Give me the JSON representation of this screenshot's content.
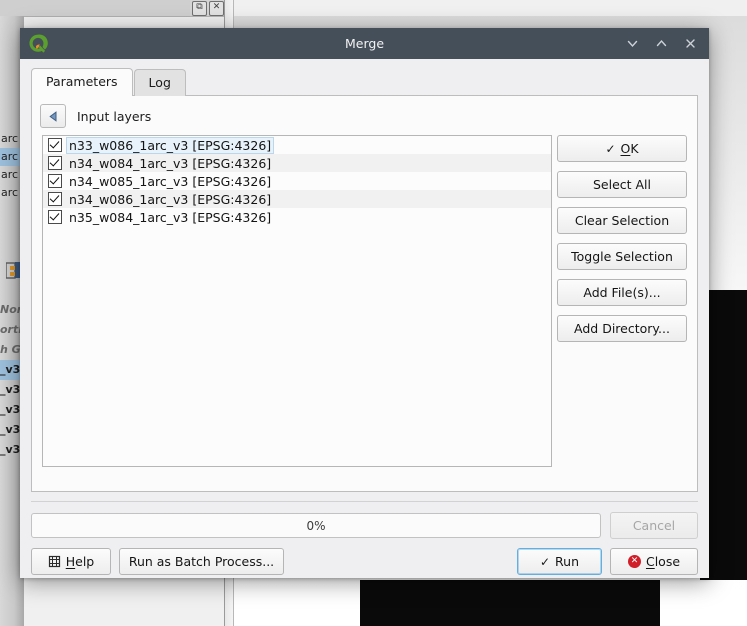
{
  "background": {
    "panel_buttons": [
      {
        "name": "restore-panel",
        "glyph": "⧉"
      },
      {
        "name": "close-panel",
        "glyph": "✕"
      }
    ],
    "layer_rows": [
      "arc",
      "arc",
      "arc",
      "arc"
    ],
    "legend_italic": [
      "Nor",
      "orth",
      "h GA"
    ],
    "legend_layers": [
      "_v3",
      "_v3",
      "_v3",
      "_v3",
      "_v3"
    ]
  },
  "dialog": {
    "title": "Merge",
    "logo_name": "qgis-logo",
    "window_buttons": [
      {
        "name": "minimize",
        "glyph": "minimize"
      },
      {
        "name": "maximize",
        "glyph": "maximize"
      },
      {
        "name": "close",
        "glyph": "close"
      }
    ],
    "tabs": [
      {
        "label": "Parameters",
        "active": true
      },
      {
        "label": "Log",
        "active": false
      }
    ],
    "parameters": {
      "section_label": "Input layers",
      "collapse_icon": "triangle-left-icon",
      "layers": [
        {
          "label": "n33_w086_1arc_v3 [EPSG:4326]",
          "checked": true,
          "focused": true
        },
        {
          "label": "n34_w084_1arc_v3 [EPSG:4326]",
          "checked": true,
          "focused": false
        },
        {
          "label": "n34_w085_1arc_v3 [EPSG:4326]",
          "checked": true,
          "focused": false
        },
        {
          "label": "n34_w086_1arc_v3 [EPSG:4326]",
          "checked": true,
          "focused": false
        },
        {
          "label": "n35_w084_1arc_v3 [EPSG:4326]",
          "checked": true,
          "focused": false
        }
      ],
      "side_buttons": [
        {
          "name": "ok-button",
          "label": "OK",
          "accel": "O",
          "icon": "check-icon"
        },
        {
          "name": "select-all-button",
          "label": "Select All",
          "icon": null
        },
        {
          "name": "clear-selection-button",
          "label": "Clear Selection",
          "icon": null
        },
        {
          "name": "toggle-selection-button",
          "label": "Toggle Selection",
          "icon": null
        },
        {
          "name": "add-files-button",
          "label": "Add File(s)...",
          "icon": null
        },
        {
          "name": "add-directory-button",
          "label": "Add Directory...",
          "icon": null
        }
      ]
    },
    "progress": {
      "value_label": "0%",
      "percent": 0
    },
    "buttons": {
      "cancel": {
        "label": "Cancel",
        "enabled": false
      },
      "help": {
        "label": "Help",
        "accel": "H",
        "icon": "help-icon"
      },
      "batch": {
        "label": "Run as Batch Process..."
      },
      "run": {
        "label": "Run",
        "icon": "check-icon",
        "default": true
      },
      "close": {
        "label": "Close",
        "accel": "C",
        "icon": "error-circle-icon"
      }
    }
  },
  "colors": {
    "titlebar": "#454f59",
    "dialog_bg": "#efeff1",
    "accent_focus": "#63b0e0",
    "row_highlight": "#e8f2fa",
    "close_icon": "#d11f2a",
    "qgis_green": "#5ba02e",
    "qgis_orange": "#e98d2b"
  }
}
